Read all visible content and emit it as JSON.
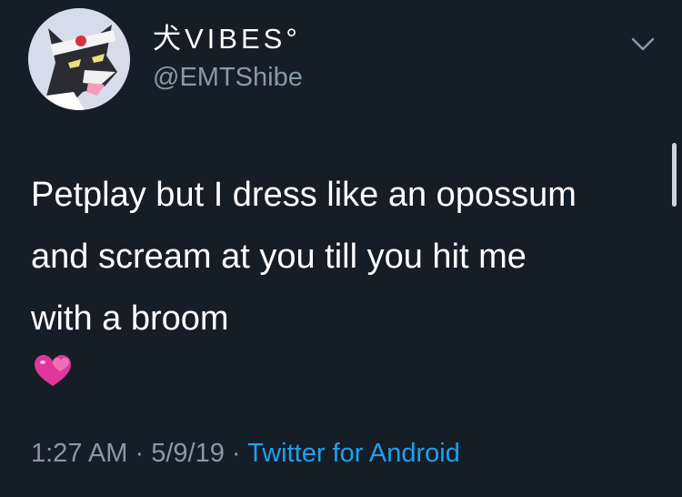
{
  "tweet": {
    "display_name": "犬VIBES°",
    "handle": "@EMTShibe",
    "body_lines": [
      "Petplay but I dress like an opossum",
      "and scream at you till you hit me",
      "with a broom"
    ],
    "emoji": "two-hearts-emoji",
    "time": "1:27 AM",
    "separator": "·",
    "date": "5/9/19",
    "source": "Twitter for Android"
  },
  "icons": {
    "menu": "chevron-down-icon",
    "avatar": "avatar-image"
  },
  "colors": {
    "background": "#151d27",
    "primary_text": "#ffffff",
    "secondary_text": "#8899a6",
    "link": "#1da1f2",
    "heart": "#e0379b"
  }
}
